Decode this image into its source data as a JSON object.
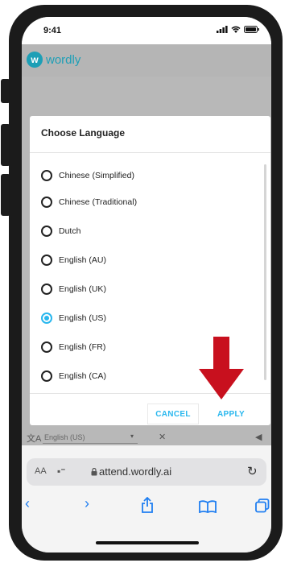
{
  "status_bar": {
    "time": "9:41"
  },
  "app": {
    "logo_letter": "w",
    "logo_text": "wordly",
    "brand_color": "#1d9fb6"
  },
  "dialog": {
    "title": "Choose Language",
    "options": [
      {
        "label": "Chinese (Simplified)",
        "selected": false
      },
      {
        "label": "Chinese (Traditional)",
        "selected": false
      },
      {
        "label": "Dutch",
        "selected": false
      },
      {
        "label": "English (AU)",
        "selected": false
      },
      {
        "label": "English (UK)",
        "selected": false
      },
      {
        "label": "English (US)",
        "selected": true
      },
      {
        "label": "English (FR)",
        "selected": false
      },
      {
        "label": "English (CA)",
        "selected": false
      }
    ],
    "cancel_label": "CANCEL",
    "apply_label": "APPLY",
    "accent_color": "#29b7ee"
  },
  "language_bar": {
    "current": "English (US)"
  },
  "browser": {
    "text_size_label": "AA",
    "url": "attend.wordly.ai"
  },
  "annotation": {
    "arrow_color": "#c8101e"
  }
}
